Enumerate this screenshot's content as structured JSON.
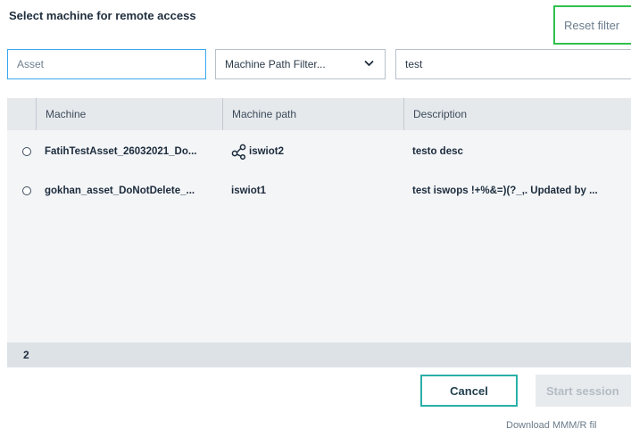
{
  "dialog": {
    "title": "Select machine for remote access",
    "reset_filter_label": "Reset filter"
  },
  "filters": {
    "asset_placeholder": "Asset",
    "asset_value": "",
    "machine_path_label": "Machine Path Filter...",
    "search_value": "test"
  },
  "table": {
    "headers": {
      "machine": "Machine",
      "machine_path": "Machine path",
      "description": "Description"
    },
    "rows": [
      {
        "machine": "FatihTestAsset_26032021_Do...",
        "machine_path": "iswiot2",
        "path_icon": "share-network-icon",
        "description": "testo desc"
      },
      {
        "machine": "gokhan_asset_DoNotDelete_...",
        "machine_path": "iswiot1",
        "description": "test iswops !+%&=)(?_,. Updated by ..."
      }
    ],
    "row_count": "2"
  },
  "actions": {
    "cancel_label": "Cancel",
    "start_session_label": "Start session",
    "download_label": "Download MMM/R fil"
  },
  "colors": {
    "reset_border": "#2fc14d",
    "asset_focus_border": "#3aa7f0",
    "cancel_border": "#2ab0a8"
  }
}
